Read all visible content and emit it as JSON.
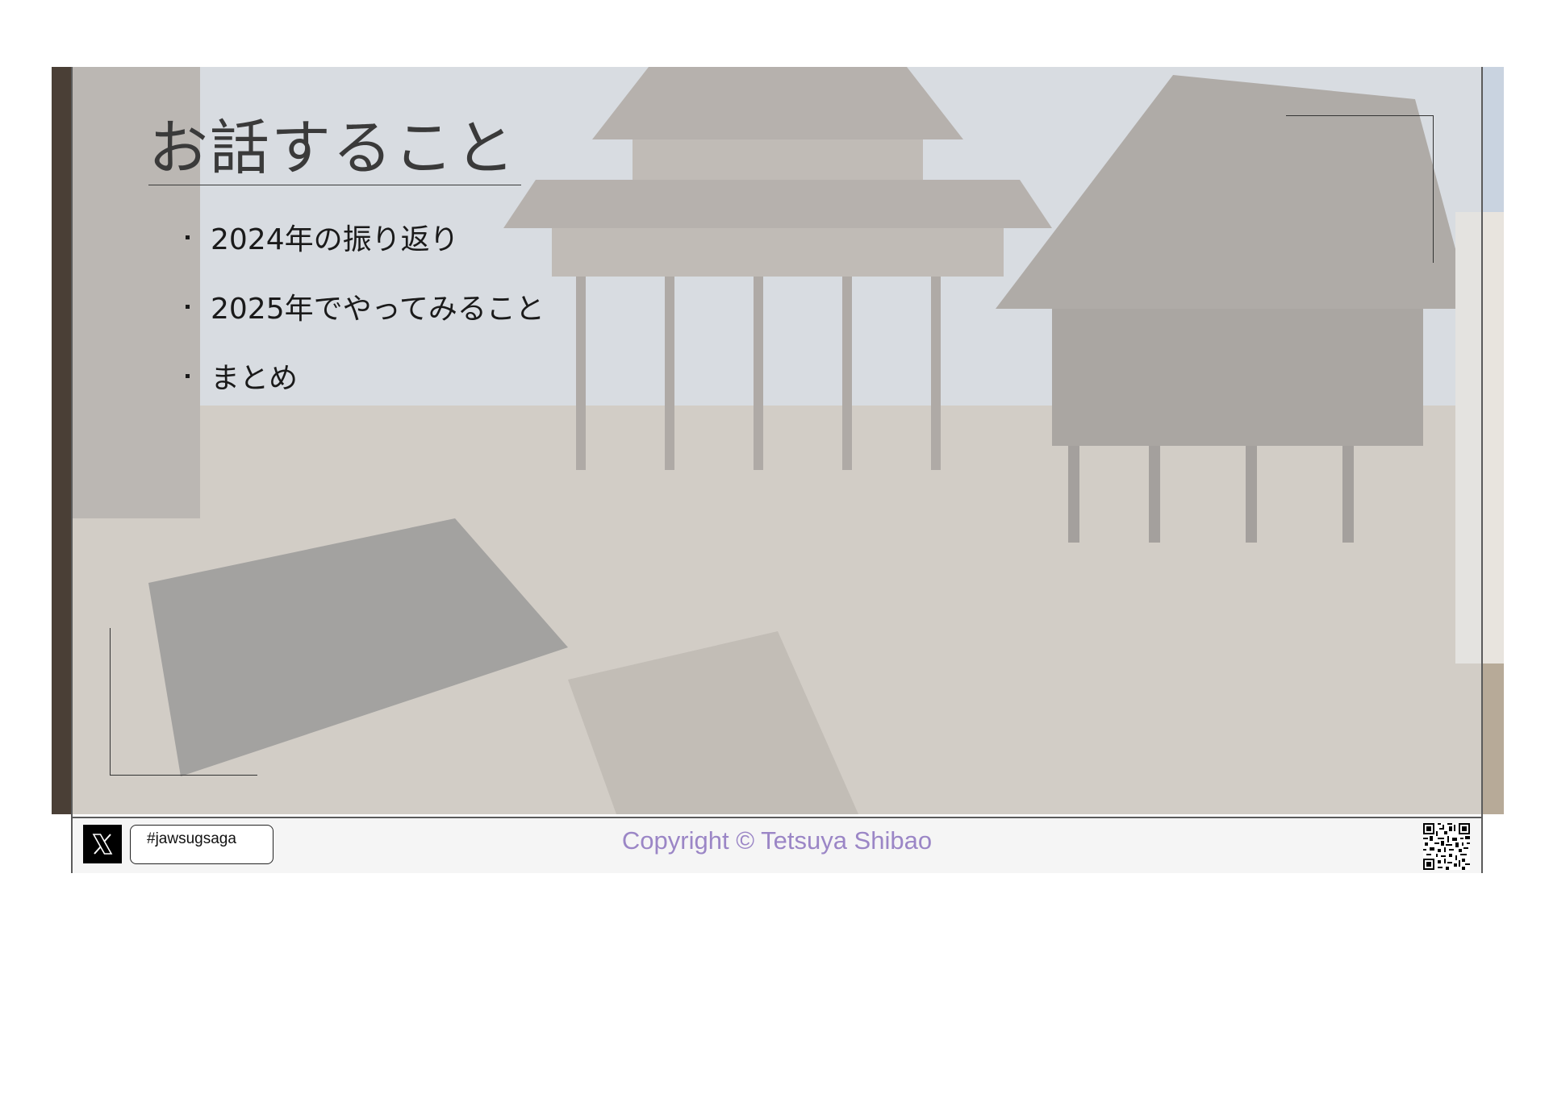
{
  "slide": {
    "title": "お話すること",
    "agenda": [
      "2024年の振り返り",
      "2025年でやってみること",
      "まとめ"
    ]
  },
  "footer": {
    "social_icon": "x-logo-icon",
    "hashtag": "#jawsugsaga",
    "copyright": "Copyright © Tetsuya Shibao",
    "qr_icon": "qr-code-icon"
  },
  "colors": {
    "copyright": "#9b86c6",
    "overlay": "#e2e2e2",
    "frame": "#5b5b5b"
  }
}
